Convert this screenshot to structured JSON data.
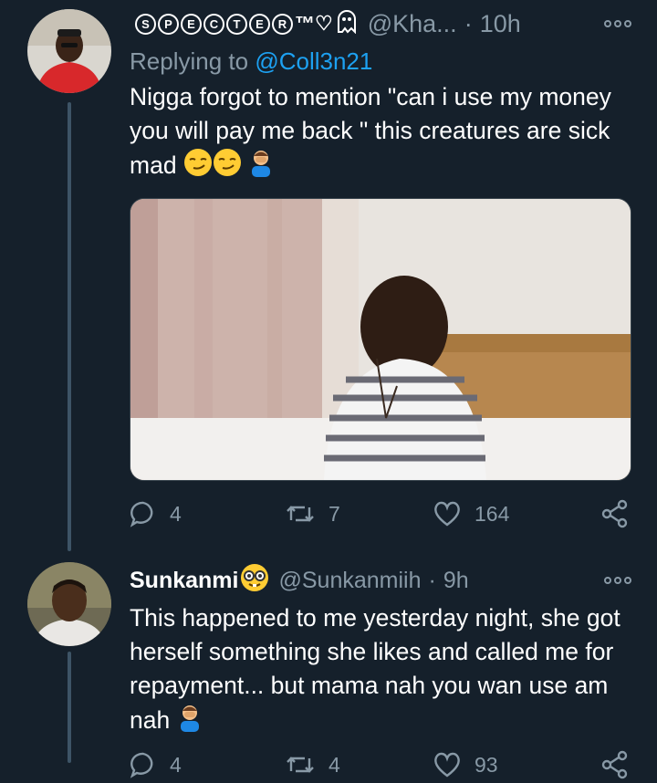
{
  "tweet1": {
    "display_name_letters": [
      "S",
      "P",
      "E",
      "C",
      "T",
      "E",
      "R"
    ],
    "display_name_suffix": "™♡",
    "handle": "@Kha...",
    "time": "10h",
    "replying_label": "Replying to",
    "replying_handle": "@Coll3n21",
    "text": "Nigga forgot to mention \"can i use my money you will pay me back \" this creatures are sick mad",
    "actions": {
      "replies": "4",
      "retweets": "7",
      "likes": "164"
    }
  },
  "tweet2": {
    "display_name": "Sunkanmi",
    "handle": "@Sunkanmiih",
    "time": "9h",
    "text": "This happened to me yesterday night, she got herself something she likes and called me for repayment... but mama nah you wan use am nah",
    "actions": {
      "replies": "4",
      "retweets": "4",
      "likes": "93"
    }
  },
  "colors": {
    "background": "#15202b",
    "secondary": "#8899a6",
    "link": "#1da1f2",
    "line": "#3d5466"
  },
  "icons": [
    "more-icon",
    "reply-icon",
    "retweet-icon",
    "like-icon",
    "share-icon",
    "ghost-emoji",
    "smirk-emoji",
    "facepalm-emoji",
    "nerd-emoji"
  ]
}
